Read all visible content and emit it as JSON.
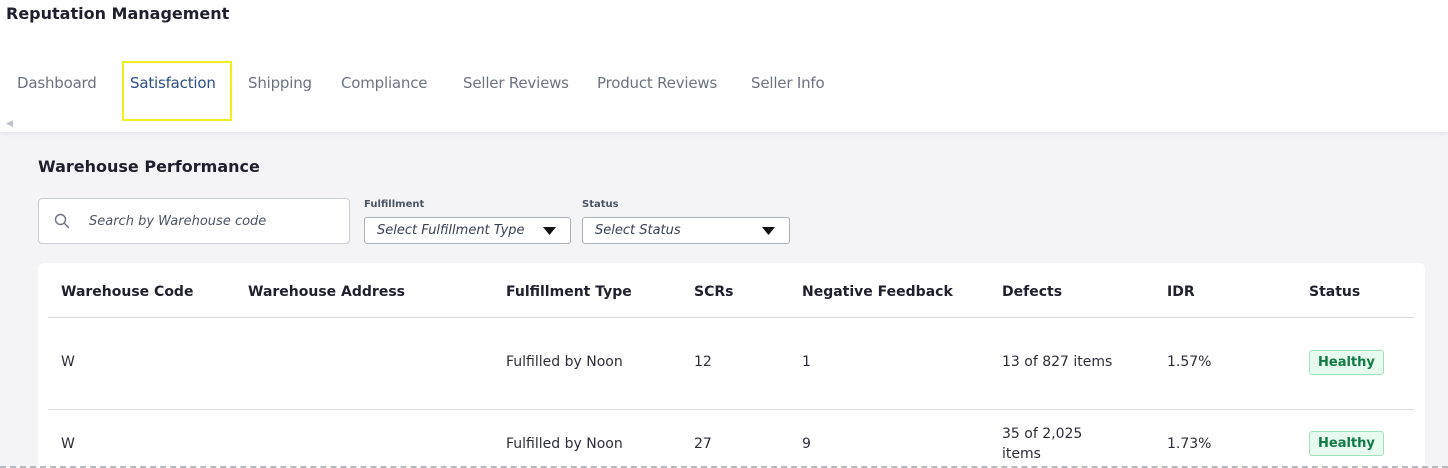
{
  "app": {
    "title": "Reputation Management"
  },
  "tabs": [
    {
      "label": "Dashboard",
      "active": false
    },
    {
      "label": "Satisfaction",
      "active": true
    },
    {
      "label": "Shipping",
      "active": false
    },
    {
      "label": "Compliance",
      "active": false
    },
    {
      "label": "Seller Reviews",
      "active": false
    },
    {
      "label": "Product Reviews",
      "active": false
    },
    {
      "label": "Seller Info",
      "active": false
    }
  ],
  "section": {
    "title": "Warehouse Performance"
  },
  "filters": {
    "search": {
      "value": "",
      "placeholder": "Search by Warehouse code"
    },
    "fulfillment": {
      "label": "Fulfillment",
      "value": "Select Fulfillment Type"
    },
    "status": {
      "label": "Status",
      "value": "Select Status"
    }
  },
  "table": {
    "columns": [
      "Warehouse Code",
      "Warehouse Address",
      "Fulfillment Type",
      "SCRs",
      "Negative Feedback",
      "Defects",
      "IDR",
      "Status"
    ],
    "rows": [
      {
        "code": "W",
        "address": "",
        "fulfillment_type": "Fulfilled by Noon",
        "scrs": "12",
        "negative_feedback": "1",
        "defects": "13 of 827 items",
        "idr": "1.57%",
        "status": "Healthy"
      },
      {
        "code": "W",
        "address": "",
        "fulfillment_type": "Fulfilled by Noon",
        "scrs": "27",
        "negative_feedback": "9",
        "defects": "35 of 2,025 items",
        "idr": "1.73%",
        "status": "Healthy"
      }
    ]
  },
  "colors": {
    "accent": "#2b4f86",
    "highlight": "#f2ee1c",
    "healthy_bg": "#e6faef",
    "healthy_text": "#117a45"
  },
  "icons": {
    "search": "search-icon",
    "dropdown": "caret-down-icon",
    "scroll": "scroll-left-icon"
  }
}
